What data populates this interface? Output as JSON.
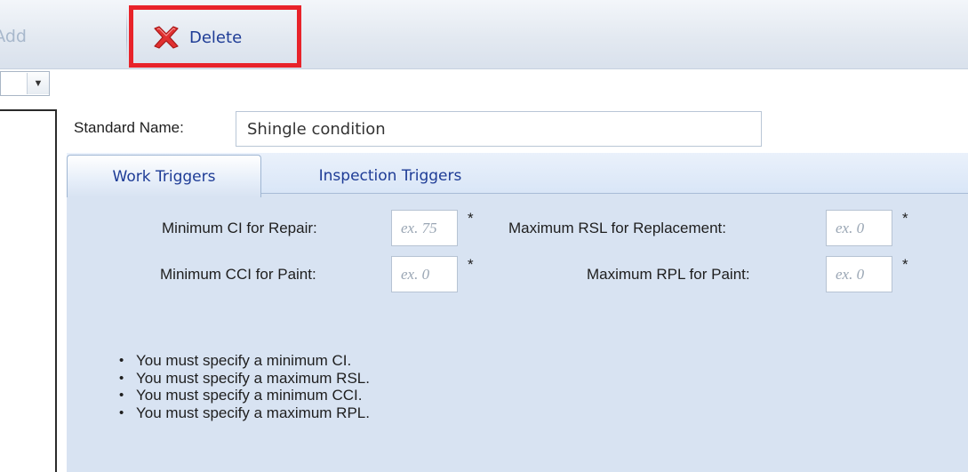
{
  "toolbar": {
    "add_label": "Add",
    "delete_label": "Delete",
    "delete_icon": "delete-x-icon",
    "highlight_color": "#e8232a"
  },
  "left_panel": {
    "dropdown_icon": "chevron-down-icon",
    "dropdown_glyph": "▼"
  },
  "standard": {
    "label": "Standard Name:",
    "value": "Shingle condition"
  },
  "tabs": [
    {
      "label": "Work Triggers",
      "active": true
    },
    {
      "label": "Inspection Triggers",
      "active": false
    }
  ],
  "fields": {
    "min_ci_repair": {
      "label": "Minimum CI for Repair:",
      "placeholder": "ex. 75",
      "required": "*"
    },
    "max_rsl_replacement": {
      "label": "Maximum RSL for Replacement:",
      "placeholder": "ex. 0",
      "required": "*"
    },
    "min_cci_paint": {
      "label": "Minimum CCI for Paint:",
      "placeholder": "ex. 0",
      "required": "*"
    },
    "max_rpl_paint": {
      "label": "Maximum RPL for Paint:",
      "placeholder": "ex. 0",
      "required": "*"
    }
  },
  "messages": [
    "You must specify a minimum CI.",
    "You must specify a maximum RSL.",
    "You must specify a minimum CCI.",
    "You must specify a maximum RPL."
  ],
  "colors": {
    "accent_text": "#1e3c96",
    "panel_bg": "#d8e3f2",
    "delete_red": "#e03030"
  }
}
